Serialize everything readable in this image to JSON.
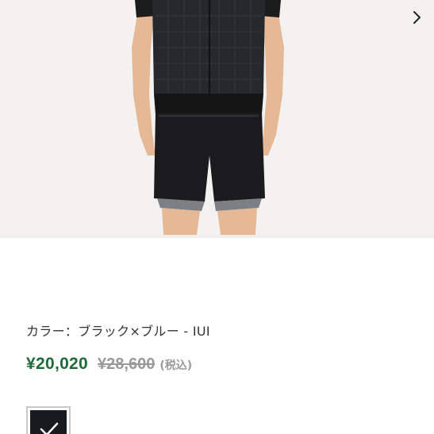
{
  "product": {
    "color_line": "カラー：ブラック×ブルー - IUI",
    "price_sale": "¥20,020",
    "price_original": "¥28,600",
    "price_tax_note": "(税込)"
  },
  "gallery": {
    "next_icon": "chevron-right-icon"
  },
  "swatches": [
    {
      "icon": "check-icon",
      "selected": true,
      "color": "#171a1f"
    }
  ],
  "colors": {
    "sale_price": "#1e6b39",
    "original_price": "#9a9a9a",
    "background": "#f3f2f1"
  }
}
